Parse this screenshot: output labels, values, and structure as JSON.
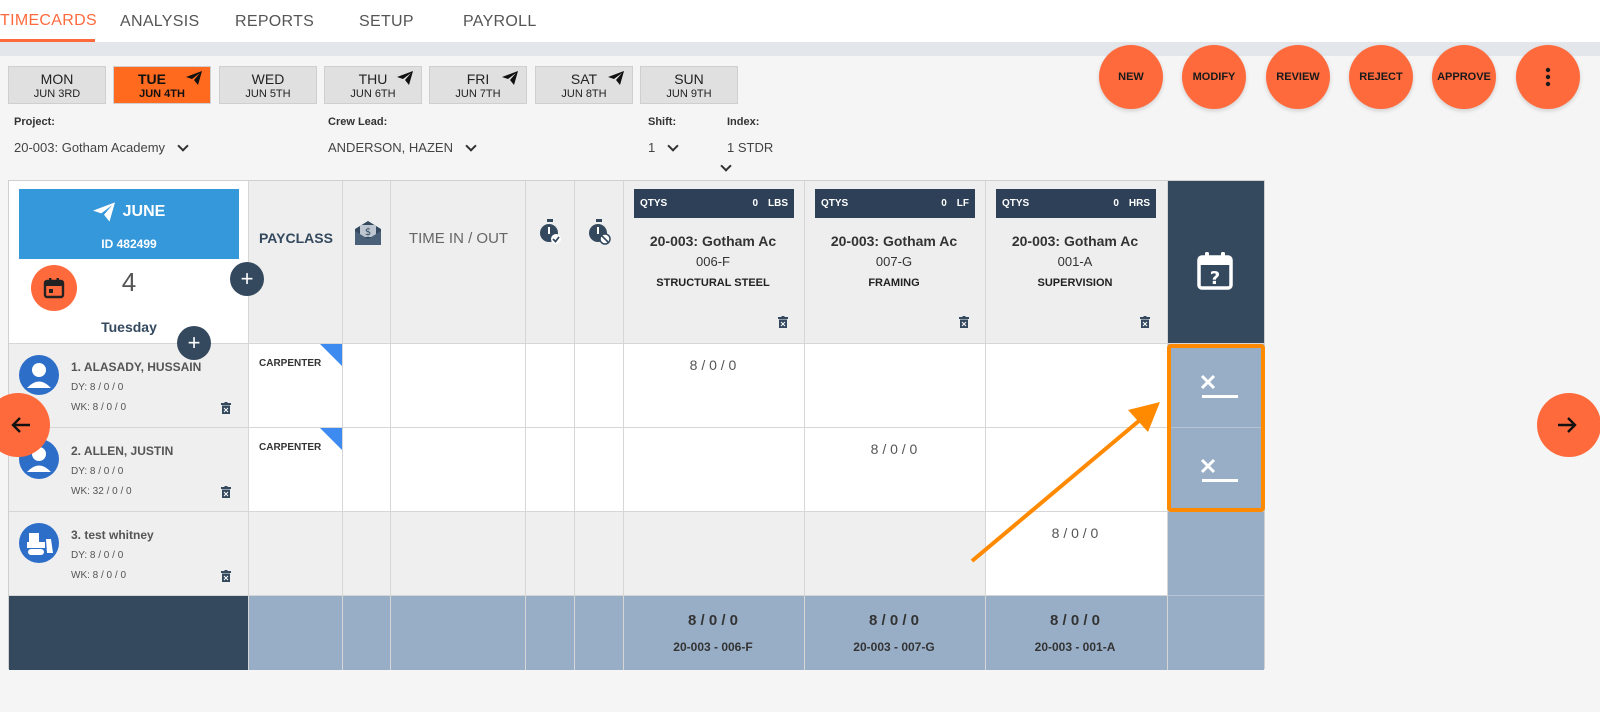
{
  "nav": {
    "tabs": [
      {
        "label": "TIMECARDS"
      },
      {
        "label": "ANALYSIS"
      },
      {
        "label": "REPORTS"
      },
      {
        "label": "SETUP"
      },
      {
        "label": "PAYROLL"
      }
    ],
    "active": "TIMECARDS"
  },
  "days": [
    {
      "name": "MON",
      "date": "JUN 3RD"
    },
    {
      "name": "TUE",
      "date": "JUN 4TH"
    },
    {
      "name": "WED",
      "date": "JUN 5TH"
    },
    {
      "name": "THU",
      "date": "JUN 6TH"
    },
    {
      "name": "FRI",
      "date": "JUN 7TH"
    },
    {
      "name": "SAT",
      "date": "JUN 8TH"
    },
    {
      "name": "SUN",
      "date": "JUN 9TH"
    }
  ],
  "actions": {
    "new": "NEW",
    "modify": "MODIFY",
    "review": "REVIEW",
    "reject": "REJECT",
    "approve": "APPROVE"
  },
  "filters": {
    "project_label": "Project:",
    "project_value": "20-003: Gotham Academy",
    "crew_label": "Crew Lead:",
    "crew_value": "ANDERSON, HAZEN",
    "shift_label": "Shift:",
    "shift_value": "1",
    "index_label": "Index:",
    "index_value": "1 STDR"
  },
  "summary": {
    "month": "JUNE",
    "id": "ID 482499",
    "day_number": "4",
    "weekday": "Tuesday"
  },
  "columns": {
    "payclass": "PAYCLASS",
    "time_in_out": "TIME IN / OUT"
  },
  "cost_columns": [
    {
      "qtys": "QTYS",
      "qty": "0",
      "unit": "LBS",
      "project": "20-003: Gotham Ac",
      "code": "006-F",
      "task": "STRUCTURAL STEEL"
    },
    {
      "qtys": "QTYS",
      "qty": "0",
      "unit": "LF",
      "project": "20-003: Gotham Ac",
      "code": "007-G",
      "task": "FRAMING"
    },
    {
      "qtys": "QTYS",
      "qty": "0",
      "unit": "HRS",
      "project": "20-003: Gotham Ac",
      "code": "001-A",
      "task": "SUPERVISION"
    }
  ],
  "workers": [
    {
      "name": "1. ALASADY, HUSSAIN",
      "dy": "DY: 8 / 0 / 0",
      "wk": "WK: 8 / 0 / 0",
      "payclass": "CARPENTER",
      "hours": [
        "8 / 0 / 0",
        "",
        ""
      ]
    },
    {
      "name": "2. ALLEN, JUSTIN",
      "dy": "DY: 8 / 0 / 0",
      "wk": "WK: 32 / 0 / 0",
      "payclass": "CARPENTER",
      "hours": [
        "",
        "8 / 0 / 0",
        ""
      ]
    },
    {
      "name": "3. test whitney",
      "dy": "DY: 8 / 0 / 0",
      "wk": "WK: 8 / 0 / 0",
      "payclass": "",
      "hours": [
        "",
        "",
        "8 / 0 / 0"
      ]
    }
  ],
  "totals": [
    {
      "value": "8 / 0 / 0",
      "code": "20-003 - 006-F"
    },
    {
      "value": "8 / 0 / 0",
      "code": "20-003 - 007-G"
    },
    {
      "value": "8 / 0 / 0",
      "code": "20-003 - 001-A"
    }
  ],
  "colors": {
    "accent": "#ff6a3d",
    "navy": "#34495e",
    "steel": "#98aec7",
    "blue": "#3498db",
    "highlight": "#ff8a00"
  }
}
